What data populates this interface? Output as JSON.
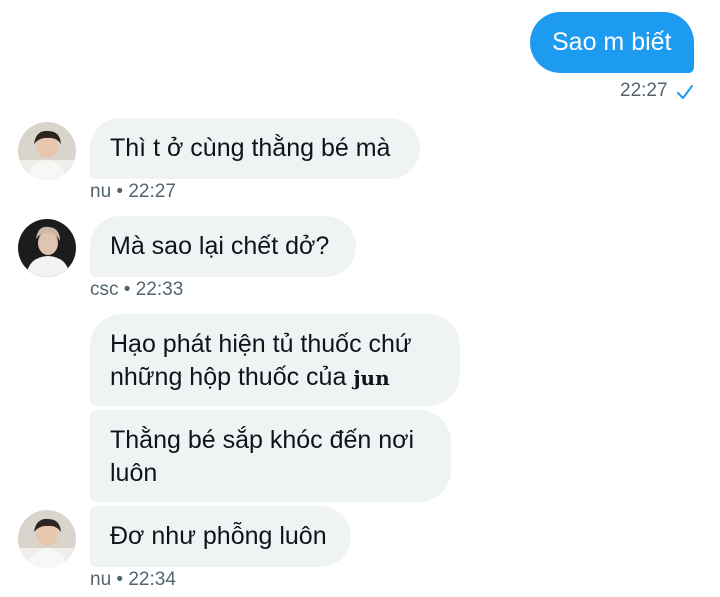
{
  "messages": [
    {
      "text": "Sao m biết"
    },
    {
      "text": "Thì t ở cùng thằng bé mà"
    },
    {
      "text": "Mà sao lại chết dở?"
    },
    {
      "line1": "Hạo phát hiện tủ thuốc chứ",
      "line2_text": "những hộp thuốc của ",
      "line2_name": "jun"
    },
    {
      "line1": "Thằng bé sắp khóc đến nơi",
      "line2": "luôn"
    },
    {
      "text": "Đơ như phỗng luôn"
    }
  ],
  "meta": {
    "outgoing_time": "22:27",
    "nu_1": "nu • 22:27",
    "csc": "csc • 22:33",
    "nu_2": "nu • 22:34"
  },
  "icons": {
    "read_receipt": "check-icon",
    "avatars": [
      "avatar-nu",
      "avatar-csc",
      "avatar-nu"
    ]
  },
  "colors": {
    "outgoing_bubble": "#1d9bf0",
    "incoming_bubble": "#eff3f4",
    "meta_text": "#536471",
    "check": "#1d9bf0"
  }
}
